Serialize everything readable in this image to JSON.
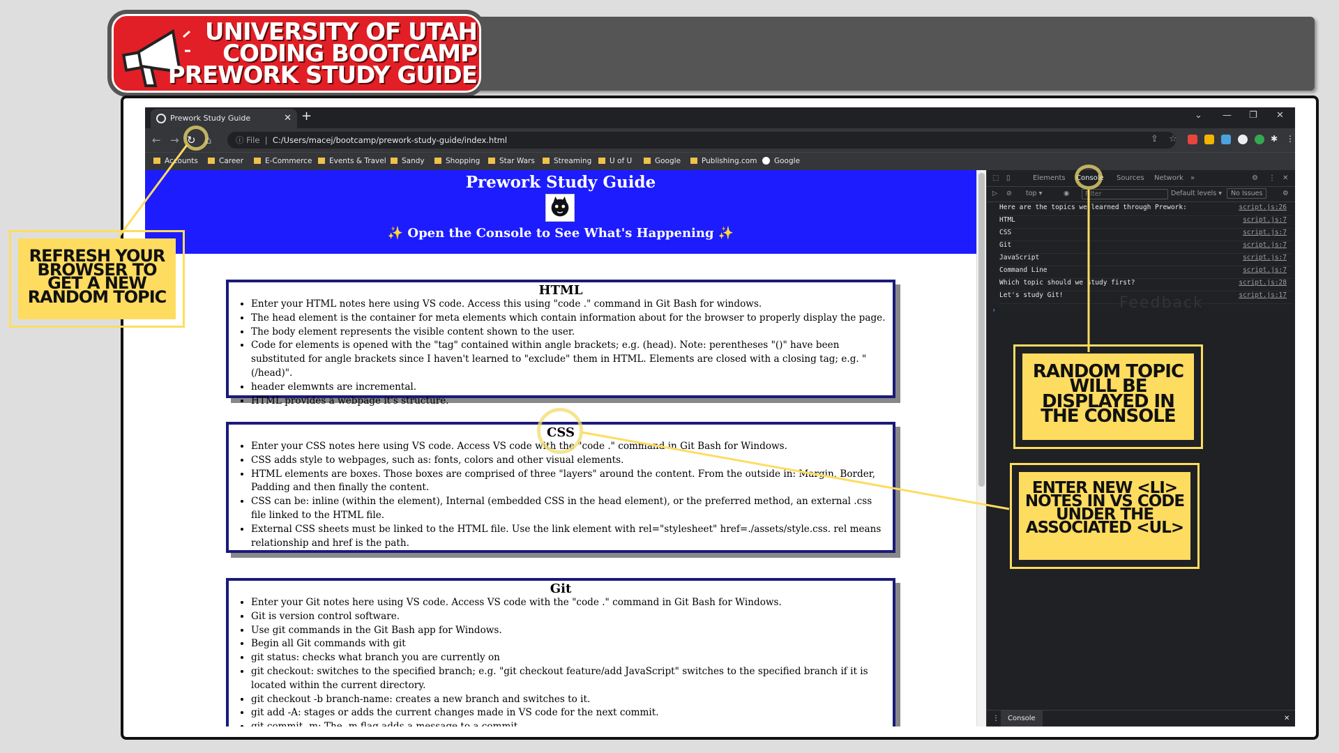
{
  "banner": {
    "line1": "UNIVERSITY OF UTAH",
    "line2": "CODING BOOTCAMP",
    "line3": "PREWORK STUDY GUIDE"
  },
  "browser": {
    "tab_title": "Prework Study Guide",
    "new_tab": "+",
    "address_prefix": "File",
    "address": "C:/Users/macej/bootcamp/prework-study-guide/index.html",
    "bookmarks": [
      "Accounts",
      "Career",
      "E-Commerce",
      "Events & Travel",
      "Sandy",
      "Shopping",
      "Star Wars",
      "Streaming",
      "U of U",
      "Google",
      "Publishing.com",
      "Google"
    ]
  },
  "page": {
    "title": "Prework Study Guide",
    "subtitle": "✨ Open the Console to See What's Happening ✨",
    "sections": [
      {
        "heading": "HTML",
        "items": [
          "Enter your HTML notes here using VS code. Access this using \"code .\" command in Git Bash for windows.",
          "The head element is the container for meta elements which contain information about for the browser to properly display the page.",
          "The body element represents the visible content shown to the user.",
          "Code for elements is opened with the \"tag\" contained within angle brackets; e.g. (head). Note: perentheses \"()\" have been substituted for angle brackets since I haven't learned to \"exclude\" them in HTML. Elements are closed with a closing tag; e.g. \"(/head)\".",
          "header elemwnts are incremental.",
          "HTML provides a webpage it's structure."
        ]
      },
      {
        "heading": "CSS",
        "items": [
          "Enter your CSS notes here using VS code. Access VS code with the \"code .\" command in Git Bash for Windows.",
          "CSS adds style to webpages, such as: fonts, colors and other visual elements.",
          "HTML elements are boxes. Those boxes are comprised of three \"layers\" around the content. From the outside in: Margin, Border, Padding and then finally the content.",
          "CSS can be: inline (within the element), Internal (embedded CSS in the head element), or the preferred method, an external .css file linked to the HTML file.",
          "External CSS sheets must be linked to the HTML file. Use the link element with rel=\"stylesheet\" href=./assets/style.css. rel means relationship and href is the path."
        ]
      },
      {
        "heading": "Git",
        "items": [
          "Enter your Git notes here using VS code. Access VS code with the \"code .\" command in Git Bash for Windows.",
          "Git is version control software.",
          "Use git commands in the Git Bash app for Windows.",
          "Begin all Git commands with git",
          "git status: checks what branch you are currently on",
          "git checkout: switches to the specified branch; e.g. \"git checkout feature/add JavaScript\" switches to the specified branch if it is located within the current directory.",
          "git checkout -b branch-name: creates a new branch and switches to it.",
          "git add -A: stages or adds the current changes made in VS code for the next commit.",
          "git commit -m: The -m flag adds a message to a commit."
        ]
      }
    ]
  },
  "devtools": {
    "tabs": [
      "Elements",
      "Console",
      "Sources",
      "Network",
      "»"
    ],
    "context": "top ▾",
    "filter_placeholder": "Filter",
    "levels": "Default levels ▾",
    "issues": "No Issues",
    "console": [
      {
        "text": "Here are the topics we learned through Prework:",
        "src": "script.js:26"
      },
      {
        "text": "HTML",
        "src": "script.js:7"
      },
      {
        "text": "CSS",
        "src": "script.js:7"
      },
      {
        "text": "Git",
        "src": "script.js:7"
      },
      {
        "text": "JavaScript",
        "src": "script.js:7"
      },
      {
        "text": "Command Line",
        "src": "script.js:7"
      },
      {
        "text": "Which topic should we study first?",
        "src": "script.js:28"
      },
      {
        "text": "Let's study Git!",
        "src": "script.js:17"
      }
    ],
    "feedback": "Feedback",
    "drawer_tab": "Console"
  },
  "annotations": {
    "refresh": "REFRESH YOUR BROWSER TO GET A NEW RANDOM TOPIC",
    "console": "RANDOM TOPIC WILL BE DISPLAYED IN THE CONSOLE",
    "enter": "ENTER NEW <LI> NOTES IN VS CODE UNDER THE ASSOCIATED <UL>",
    "highlight_color": "#fedc60"
  }
}
